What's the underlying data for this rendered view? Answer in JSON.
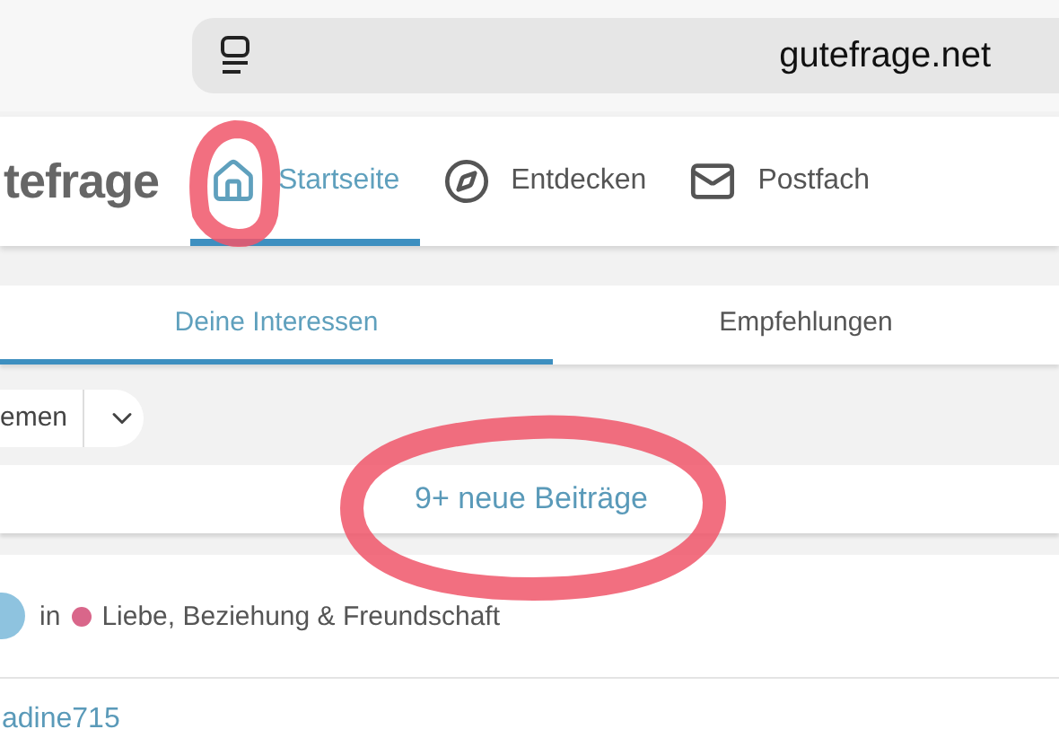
{
  "browser": {
    "address": "gutefrage.net"
  },
  "header": {
    "logo": "tefrage",
    "nav": [
      {
        "label": "Startseite",
        "selected": true
      },
      {
        "label": "Entdecken",
        "selected": false
      },
      {
        "label": "Postfach",
        "selected": false
      }
    ]
  },
  "feed_tabs": [
    {
      "label": "Deine Interessen",
      "selected": true
    },
    {
      "label": "Empfehlungen",
      "selected": false
    }
  ],
  "filter": {
    "label": "emen"
  },
  "new_posts": {
    "label": "9+ neue Beiträge"
  },
  "post": {
    "prefix": "in",
    "category": "Liebe, Beziehung & Freundschaft",
    "color": "#d9668a",
    "author": "adine715"
  },
  "annotations": [
    {
      "kind": "blob"
    },
    {
      "kind": "ring"
    }
  ]
}
